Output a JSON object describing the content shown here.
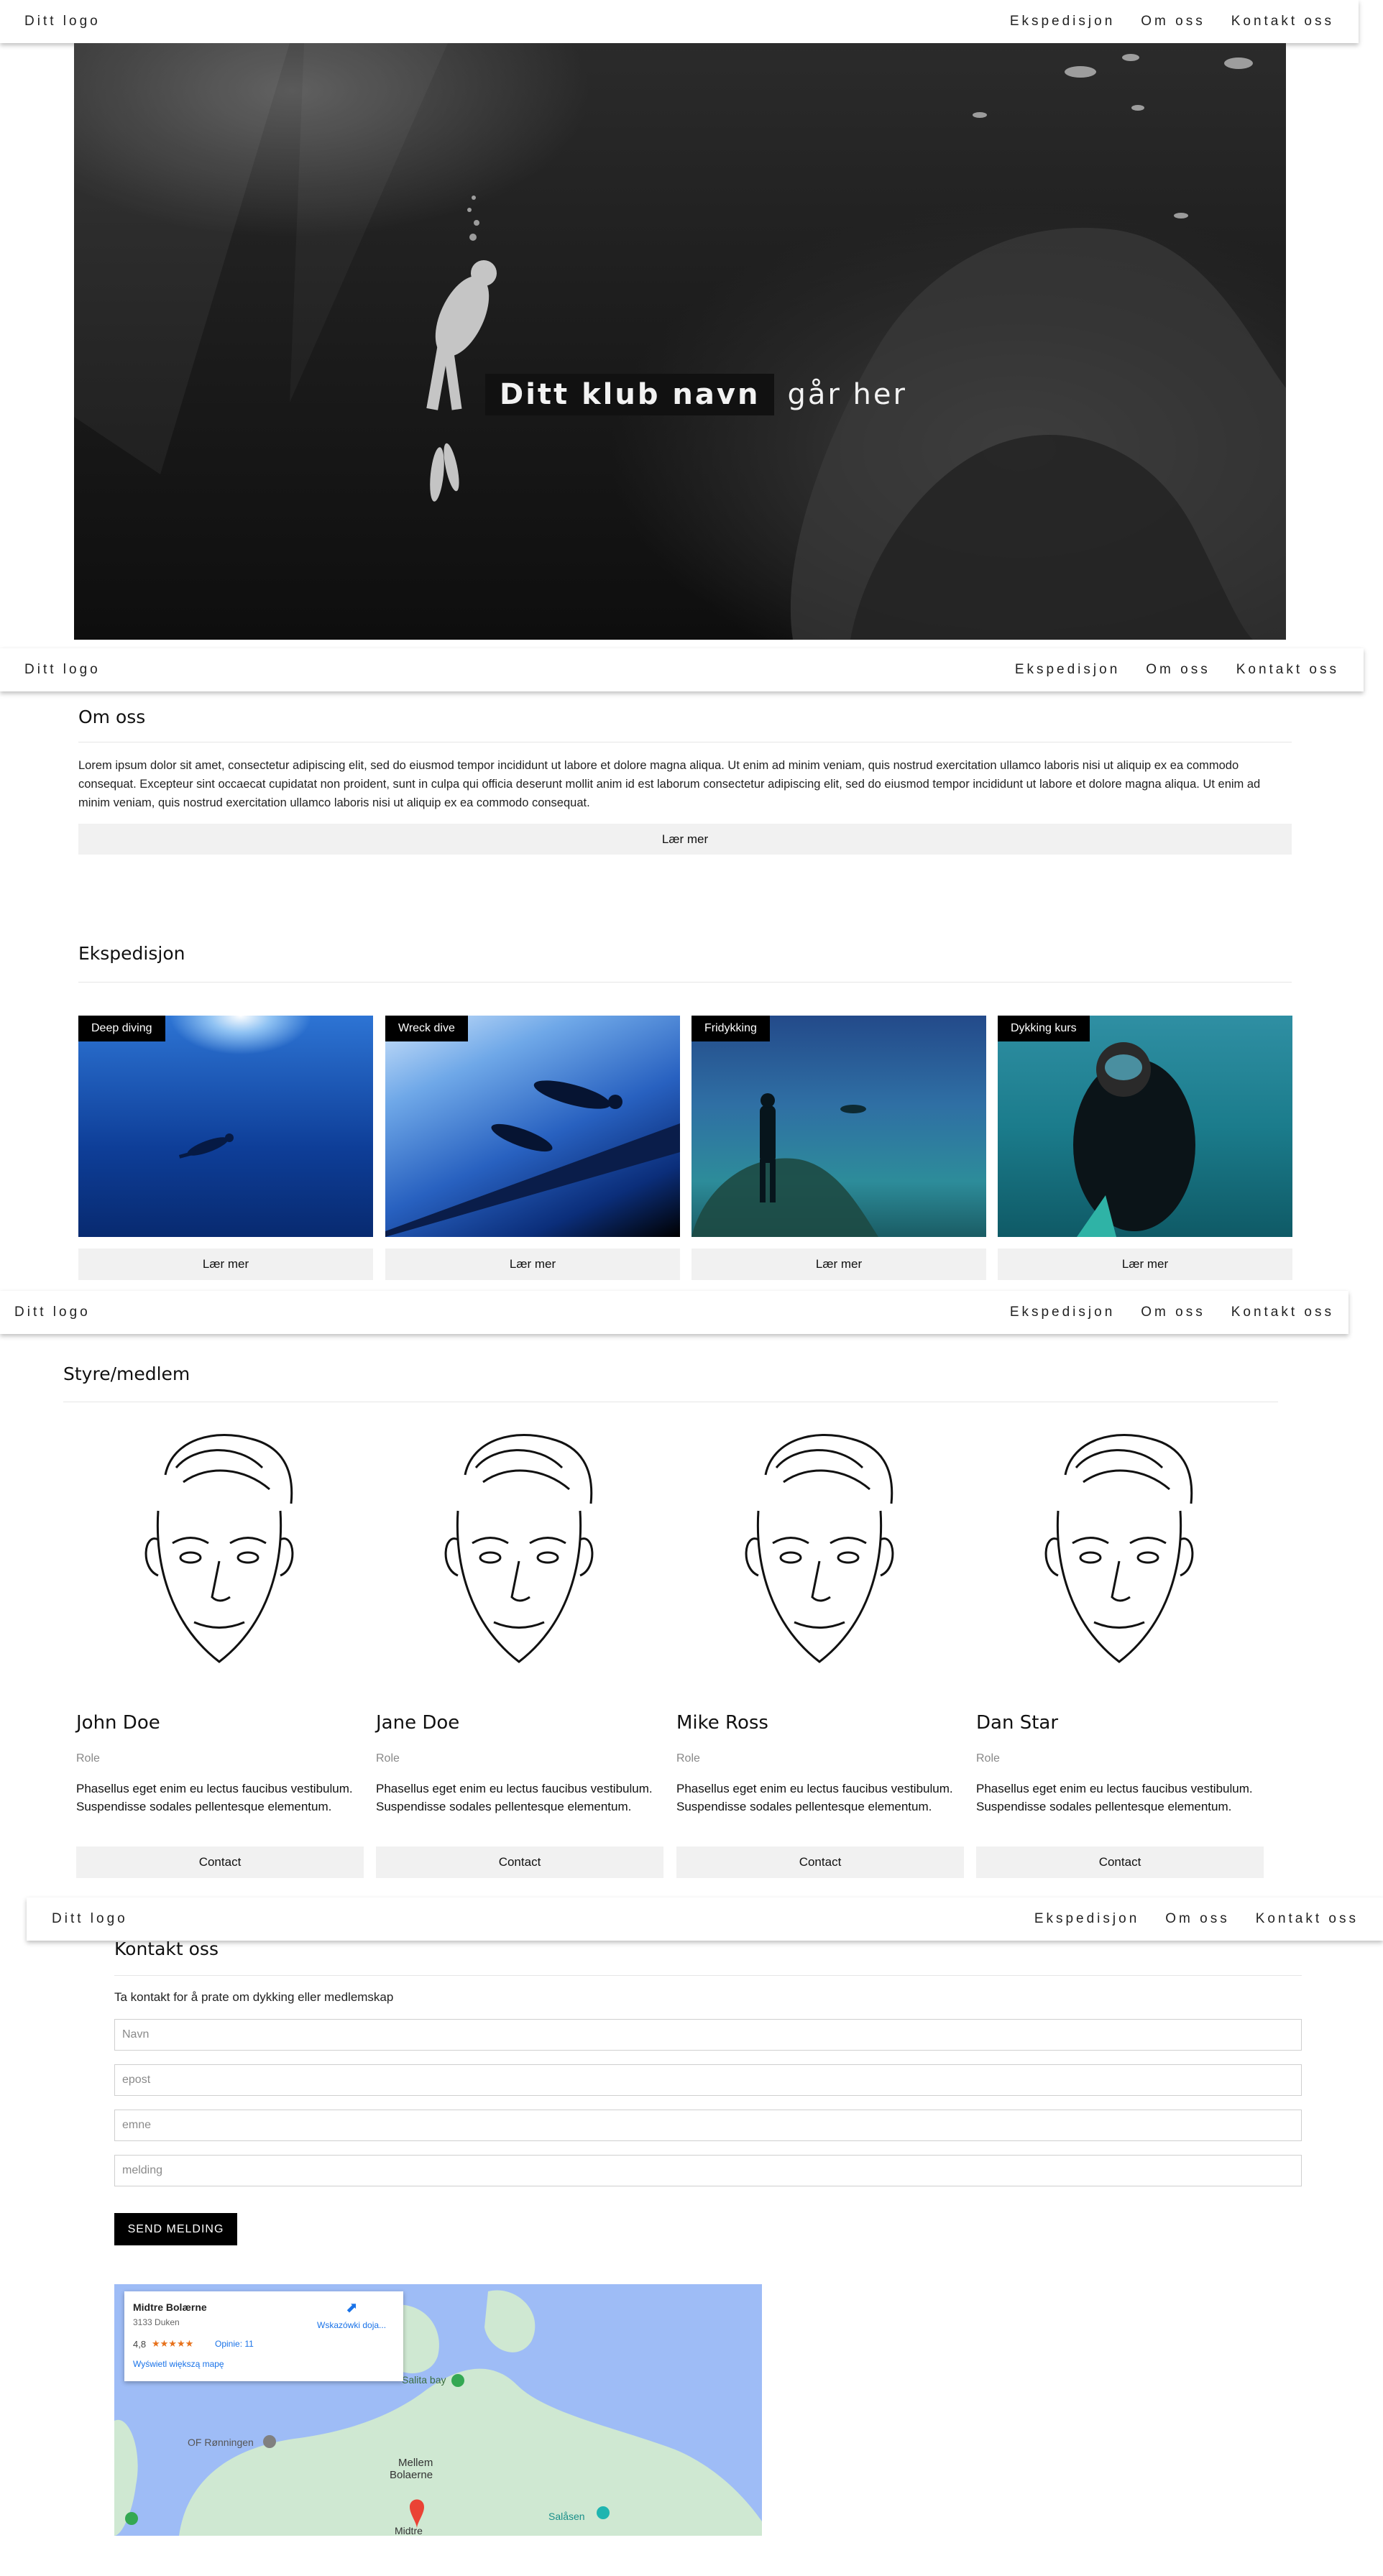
{
  "nav": {
    "logo": "Ditt logo",
    "links": [
      "Ekspedisjon",
      "Om oss",
      "Kontakt oss"
    ]
  },
  "hero": {
    "title_strong": "Ditt klub navn",
    "title_rest": "går her"
  },
  "about": {
    "title": "Om oss",
    "text": "Lorem ipsum dolor sit amet, consectetur adipiscing elit, sed do eiusmod tempor incididunt ut labore et dolore magna aliqua. Ut enim ad minim veniam, quis nostrud exercitation ullamco laboris nisi ut aliquip ex ea commodo consequat. Excepteur sint occaecat cupidatat non proident, sunt in culpa qui officia deserunt mollit anim id est laborum consectetur adipiscing elit, sed do eiusmod tempor incididunt ut labore et dolore magna aliqua. Ut enim ad minim veniam, quis nostrud exercitation ullamco laboris nisi ut aliquip ex ea commodo consequat.",
    "button": "Lær mer"
  },
  "expedition": {
    "title": "Ekspedisjon",
    "cards": [
      {
        "label": "Deep diving",
        "button": "Lær mer"
      },
      {
        "label": "Wreck dive",
        "button": "Lær mer"
      },
      {
        "label": "Fridykking",
        "button": "Lær mer"
      },
      {
        "label": "Dykking kurs",
        "button": "Lær mer"
      }
    ]
  },
  "members": {
    "title": "Styre/medlem",
    "people": [
      {
        "name": "John Doe",
        "role": "Role",
        "text": "Phasellus eget enim eu lectus faucibus vestibulum. Suspendisse sodales pellentesque elementum.",
        "button": "Contact"
      },
      {
        "name": "Jane Doe",
        "role": "Role",
        "text": "Phasellus eget enim eu lectus faucibus vestibulum. Suspendisse sodales pellentesque elementum.",
        "button": "Contact"
      },
      {
        "name": "Mike Ross",
        "role": "Role",
        "text": "Phasellus eget enim eu lectus faucibus vestibulum. Suspendisse sodales pellentesque elementum.",
        "button": "Contact"
      },
      {
        "name": "Dan Star",
        "role": "Role",
        "text": "Phasellus eget enim eu lectus faucibus vestibulum. Suspendisse sodales pellentesque elementum.",
        "button": "Contact"
      }
    ]
  },
  "contact": {
    "title": "Kontakt oss",
    "intro": "Ta kontakt for å prate om dykking eller medlemskap",
    "placeholders": {
      "name": "Navn",
      "email": "epost",
      "subject": "emne",
      "message": "melding"
    },
    "send": "SEND MELDING"
  },
  "map": {
    "place": "Midtre Bolærne",
    "address": "3133 Duken",
    "rating": "4,8",
    "stars": "★★★★★",
    "reviews": "Opinie: 11",
    "directions": "Wskazówki doja...",
    "larger": "Wyświetl większą mapę",
    "labels": [
      "Salita bay",
      "OF Rønningen",
      "Mellem",
      "Bolaerne",
      "Salåsen",
      "Midtre"
    ]
  },
  "colors": {
    "accent_dark": "#000000",
    "button_grey": "#f1f1f1",
    "link_blue": "#1a73e8"
  }
}
